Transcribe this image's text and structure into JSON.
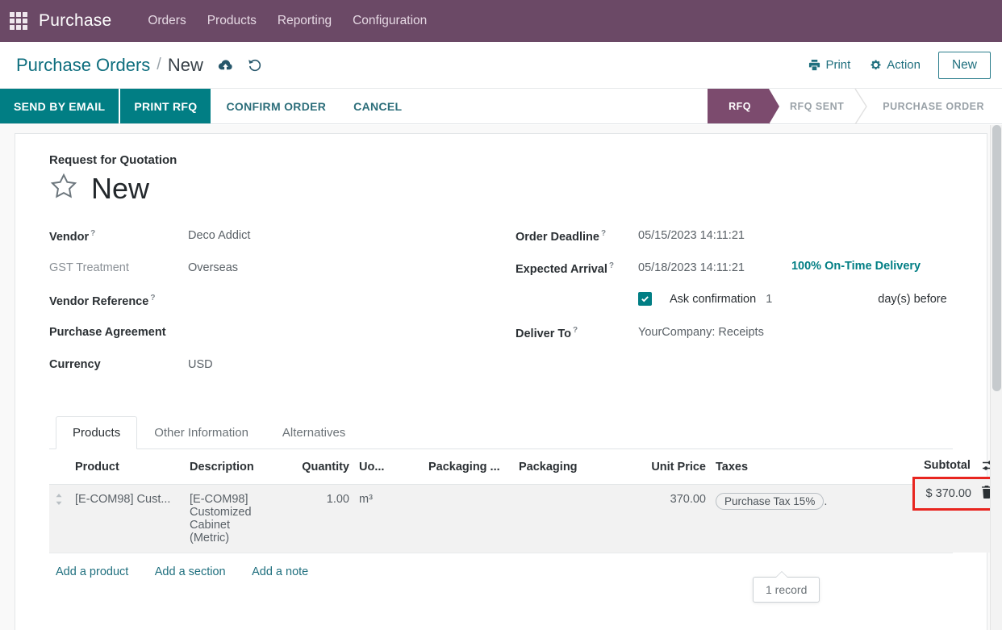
{
  "navbar": {
    "apps_icon": "apps-grid-icon",
    "brand": "Purchase",
    "menus": [
      "Orders",
      "Products",
      "Reporting",
      "Configuration"
    ]
  },
  "control_panel": {
    "breadcrumb_root": "Purchase Orders",
    "breadcrumb_sep": "/",
    "breadcrumb_current": "New",
    "save_icon": "cloud-upload-icon",
    "discard_icon": "undo-icon",
    "print_label": "Print",
    "print_icon": "printer-icon",
    "action_label": "Action",
    "action_icon": "gear-icon",
    "new_label": "New"
  },
  "statusbar": {
    "buttons": [
      {
        "label": "SEND BY EMAIL",
        "style": "primary"
      },
      {
        "label": "PRINT RFQ",
        "style": "primary"
      },
      {
        "label": "CONFIRM ORDER",
        "style": "secondary"
      },
      {
        "label": "CANCEL",
        "style": "secondary"
      }
    ],
    "stages": [
      {
        "label": "RFQ",
        "active": true
      },
      {
        "label": "RFQ SENT",
        "active": false
      },
      {
        "label": "PURCHASE ORDER",
        "active": false
      }
    ]
  },
  "record": {
    "subtitle": "Request for Quotation",
    "title": "New",
    "star_icon": "star-outline-icon"
  },
  "fields_left": [
    {
      "label": "Vendor",
      "help": "?",
      "value": "Deco Addict",
      "muted": false
    },
    {
      "label": "GST Treatment",
      "help": "",
      "value": "Overseas",
      "muted": true
    },
    {
      "label": "Vendor Reference",
      "help": "?",
      "value": "",
      "muted": false
    },
    {
      "label": "Purchase Agreement",
      "help": "",
      "value": "",
      "muted": false
    },
    {
      "label": "Currency",
      "help": "",
      "value": "USD",
      "muted": false
    }
  ],
  "fields_right": {
    "order_deadline_label": "Order Deadline",
    "order_deadline_help": "?",
    "order_deadline_value": "05/15/2023 14:11:21",
    "expected_arrival_label": "Expected Arrival",
    "expected_arrival_help": "?",
    "expected_arrival_value": "05/18/2023 14:11:21",
    "on_time_delivery": "100% On-Time Delivery",
    "ask_confirmation_label": "Ask confirmation",
    "ask_confirmation_checked": true,
    "ask_confirmation_days": "1",
    "days_before_label": "day(s) before",
    "deliver_to_label": "Deliver To",
    "deliver_to_help": "?",
    "deliver_to_value": "YourCompany: Receipts"
  },
  "tabs": [
    {
      "label": "Products",
      "active": true
    },
    {
      "label": "Other Information",
      "active": false
    },
    {
      "label": "Alternatives",
      "active": false
    }
  ],
  "lines_table": {
    "headers": {
      "product": "Product",
      "description": "Description",
      "quantity": "Quantity",
      "uom": "Uo...",
      "packaging_qty": "Packaging ...",
      "packaging": "Packaging",
      "unit_price": "Unit Price",
      "taxes": "Taxes",
      "subtotal": "Subtotal"
    },
    "optional_columns_icon": "sliders-toggle-icon",
    "rows": [
      {
        "handle_icon": "drag-handle-icon",
        "product": "[E-COM98] Cust...",
        "description": "[E-COM98] Customized Cabinet (Metric)",
        "quantity": "1.00",
        "uom": "m³",
        "packaging_qty": "",
        "packaging": "",
        "unit_price": "370.00",
        "tax_badge": "Purchase Tax 15%",
        "tax_suffix": ".",
        "subtotal": "$ 370.00",
        "delete_icon": "trash-icon",
        "highlighted": true
      }
    ],
    "add_links": [
      "Add a product",
      "Add a section",
      "Add a note"
    ]
  },
  "tooltip": {
    "text": "1 record"
  },
  "colors": {
    "navbar_purple": "#6B4966",
    "stage_purple": "#7C4B6E",
    "accent_teal": "#017E84",
    "link_teal": "#1F6F7E",
    "highlight_red": "#E8251F"
  }
}
